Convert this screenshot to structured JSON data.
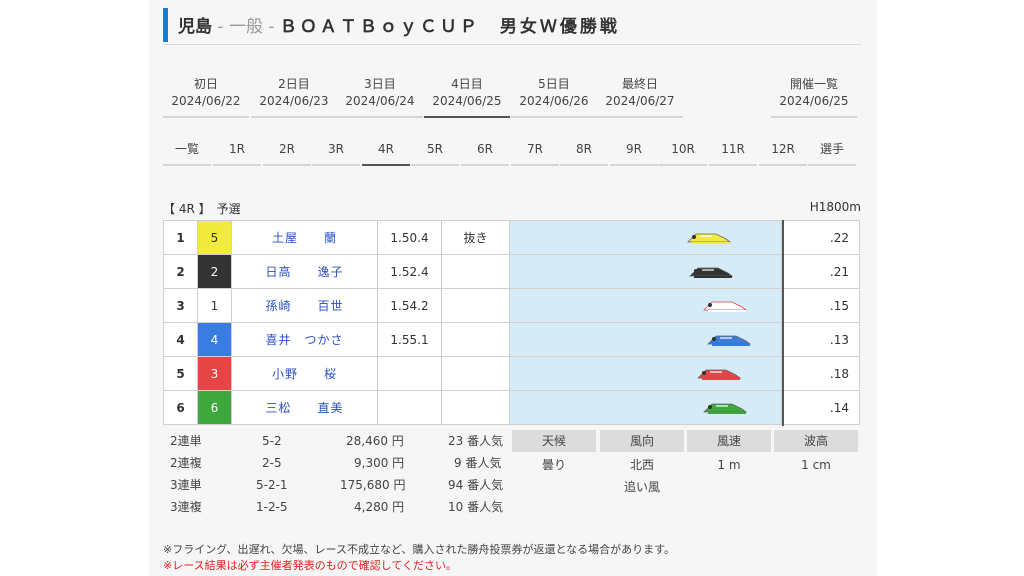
{
  "title": {
    "venue": "児島",
    "sep1": " - ",
    "grade": "一般",
    "sep2": " - ",
    "event": "ＢＯＡＴＢｏｙＣＵＰ　男女Ｗ優勝戦"
  },
  "day_tabs": [
    {
      "label": "初日",
      "date": "2024/06/22"
    },
    {
      "label": "2日目",
      "date": "2024/06/23"
    },
    {
      "label": "3日目",
      "date": "2024/06/24"
    },
    {
      "label": "4日目",
      "date": "2024/06/25"
    },
    {
      "label": "5日目",
      "date": "2024/06/26"
    },
    {
      "label": "最終日",
      "date": "2024/06/27"
    },
    {
      "label": "開催一覧",
      "date": "2024/06/25"
    }
  ],
  "race_tabs": [
    "一覧",
    "1R",
    "2R",
    "3R",
    "4R",
    "5R",
    "6R",
    "7R",
    "8R",
    "9R",
    "10R",
    "11R",
    "12R",
    "選手"
  ],
  "race_header": {
    "race": "【 4R 】　予選",
    "distance": "H1800m"
  },
  "results": [
    {
      "pos": "1",
      "boat": "5",
      "name": "土屋　　蘭",
      "time": "1.50.4",
      "kimarite": "抜き",
      "st": ".22",
      "color": "#f2ea3c"
    },
    {
      "pos": "2",
      "boat": "2",
      "name": "日高　　逸子",
      "time": "1.52.4",
      "kimarite": "",
      "st": ".21",
      "color": "#333333"
    },
    {
      "pos": "3",
      "boat": "1",
      "name": "孫崎　　百世",
      "time": "1.54.2",
      "kimarite": "",
      "st": ".15",
      "color": "#ffffff"
    },
    {
      "pos": "4",
      "boat": "4",
      "name": "喜井　つかさ",
      "time": "1.55.1",
      "kimarite": "",
      "st": ".13",
      "color": "#3a7de0"
    },
    {
      "pos": "5",
      "boat": "3",
      "name": "小野　　桜",
      "time": "",
      "kimarite": "",
      "st": ".18",
      "color": "#e54545"
    },
    {
      "pos": "6",
      "boat": "6",
      "name": "三松　　直美",
      "time": "",
      "kimarite": "",
      "st": ".14",
      "color": "#3ea83e"
    }
  ],
  "odds": [
    {
      "type": "2連単",
      "combo": "5-2",
      "payout": "28,460 円",
      "popularity": "23 番人気"
    },
    {
      "type": "2連複",
      "combo": "2-5",
      "payout": "9,300 円",
      "popularity": "9 番人気"
    },
    {
      "type": "3連単",
      "combo": "5-2-1",
      "payout": "175,680 円",
      "popularity": "94 番人気"
    },
    {
      "type": "3連複",
      "combo": "1-2-5",
      "payout": "4,280 円",
      "popularity": "10 番人気"
    }
  ],
  "weather": {
    "headers": [
      "天候",
      "風向",
      "風速",
      "波高"
    ],
    "values": [
      "曇り",
      "北西",
      "1 m",
      "1 cm"
    ],
    "wind_desc": "追い風"
  },
  "notes": {
    "line1": "※フライング、出遅れ、欠場、レース不成立など、購入された勝舟投票券が返還となる場合があります。",
    "line2": "※レース結果は必ず主催者発表のもので確認してください。"
  },
  "colors": {
    "accent": "#1a7dcc",
    "track": "#d6ebf8",
    "name_link": "#2a4fc4",
    "warning": "#e02020"
  }
}
